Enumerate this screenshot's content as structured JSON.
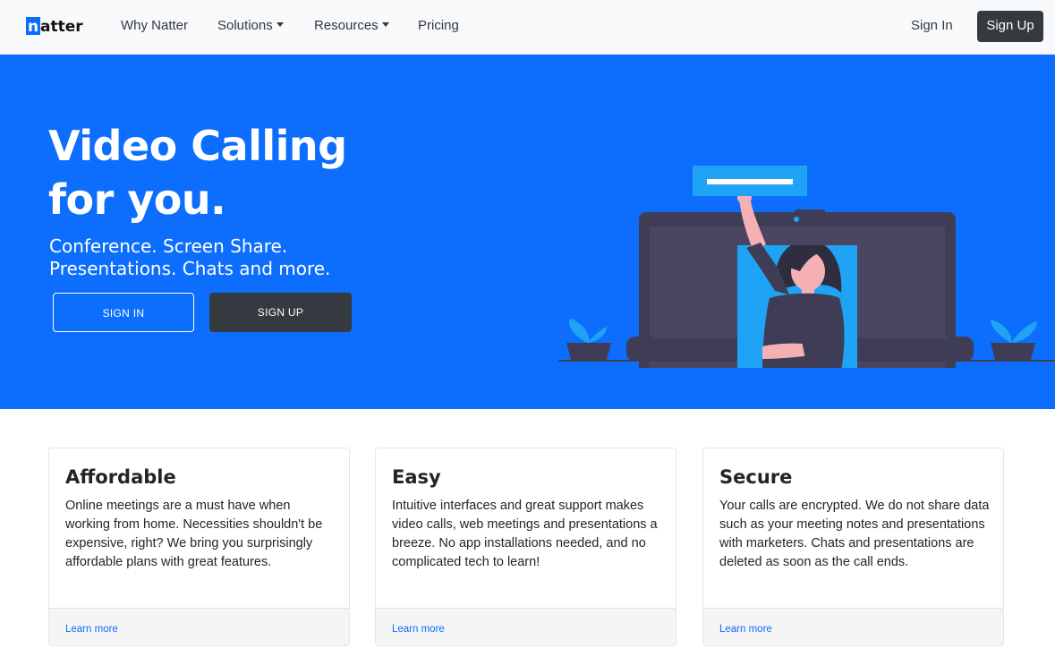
{
  "nav": {
    "logo_first": "n",
    "logo_rest": "atter",
    "links": [
      "Why Natter",
      "Solutions",
      "Resources",
      "Pricing"
    ],
    "sign_in": "Sign In",
    "sign_up": "Sign Up"
  },
  "hero": {
    "title_line1": "Video Calling",
    "title_line2": "for you.",
    "subtitle_line1": "Conference. Screen Share.",
    "subtitle_line2": "Presentations. Chats and more.",
    "sign_in_button": "SIGN IN",
    "sign_up_button": "SIGN UP"
  },
  "cards": [
    {
      "title": "Affordable",
      "text": "Online meetings are a must have when working from home. Necessities shouldn't be expensive, right? We bring you surprisingly affordable plans with great features.",
      "link": "Learn more"
    },
    {
      "title": "Easy",
      "text": "Intuitive interfaces and great support makes video calls, web meetings and presentations a breeze. No app installations needed, and no complicated tech to learn!",
      "link": "Learn more"
    },
    {
      "title": "Secure",
      "text": "Your calls are encrypted. We do not share data such as your meeting notes and presentations with marketers. Chats and presentations are deleted as soon as the call ends.",
      "link": "Learn more"
    }
  ],
  "colors": {
    "brand_blue": "#0d6efd",
    "dark": "#343a40",
    "illustration_accent": "#1fa3f5"
  }
}
